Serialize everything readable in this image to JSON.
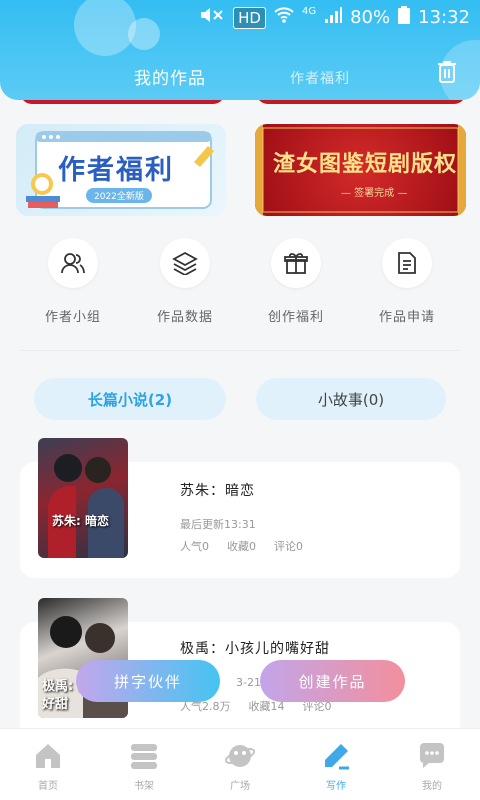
{
  "status_bar": {
    "hd": "HD",
    "network": "4G",
    "battery": "80%",
    "time": "13:32"
  },
  "header": {
    "tabs": [
      {
        "label": "我的作品",
        "active": true
      },
      {
        "label": "作者福利",
        "active": false
      }
    ],
    "trash_icon": "trash-icon"
  },
  "banners": {
    "left_title": "作者福利",
    "left_subtitle": "2022全新版",
    "right_title": "渣女图鉴短剧版权",
    "right_subtitle": "— 签署完成 —"
  },
  "menu": [
    {
      "label": "作者小组",
      "icon": "group-icon"
    },
    {
      "label": "作品数据",
      "icon": "layers-icon"
    },
    {
      "label": "创作福利",
      "icon": "gift-icon"
    },
    {
      "label": "作品申请",
      "icon": "document-icon"
    }
  ],
  "segments": {
    "long": "长篇小说(2)",
    "short": "小故事(0)"
  },
  "works": [
    {
      "cover_text": "苏朱: 暗恋",
      "title": "苏朱：暗恋",
      "updated": "最后更新13:31",
      "stats": [
        "人气0",
        "收藏0",
        "评论0"
      ]
    },
    {
      "cover_text": "极禹: 的嘴好甜",
      "title": "极禹：小孩儿的嘴好甜",
      "updated": "3-21",
      "stats": [
        "人气2.8万",
        "收藏14",
        "评论0"
      ]
    }
  ],
  "fabs": {
    "partner": "拼字伙伴",
    "create": "创建作品"
  },
  "bottom_nav": [
    {
      "label": "首页",
      "icon": "home-icon",
      "active": false
    },
    {
      "label": "书架",
      "icon": "bookshelf-icon",
      "active": false
    },
    {
      "label": "广场",
      "icon": "planet-icon",
      "active": false
    },
    {
      "label": "写作",
      "icon": "pen-icon",
      "active": true
    },
    {
      "label": "我的",
      "icon": "chat-icon",
      "active": false
    }
  ],
  "colors": {
    "header": "#33bdf2",
    "accent": "#2ba3e4",
    "segment_bg": "#e1f1fb",
    "fab_pink": "#f38f9c"
  }
}
